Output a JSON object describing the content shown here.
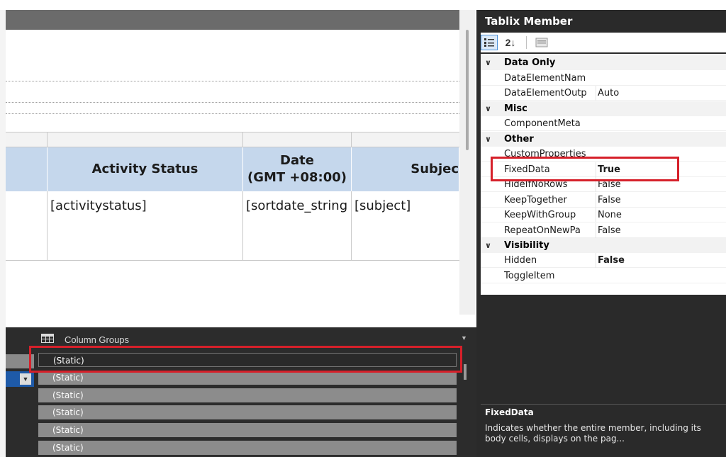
{
  "designer": {
    "headers": [
      {
        "label": ""
      },
      {
        "label": "Activity Status"
      },
      {
        "label": "Date\n(GMT +08:00)"
      },
      {
        "label": "Subjec"
      }
    ],
    "cells": [
      "",
      "[activitystatus]",
      "[sortdate_string",
      "[subject]"
    ]
  },
  "grouping": {
    "column_groups_title": "Column Groups",
    "column_groups": [
      "(Static)",
      "(Static)",
      "(Static)",
      "(Static)",
      "(Static)",
      "(Static)"
    ]
  },
  "properties": {
    "title": "Tablix Member",
    "toolbar": {
      "categorized_icon": "categorized-icon",
      "alphabetical_label": "2↓",
      "property_pages_icon": "property-pages-icon"
    },
    "categories": [
      {
        "name": "Data Only",
        "rows": [
          {
            "name": "DataElementNam",
            "value": ""
          },
          {
            "name": "DataElementOutp",
            "value": "Auto"
          }
        ]
      },
      {
        "name": "Misc",
        "rows": [
          {
            "name": "ComponentMeta",
            "value": ""
          }
        ]
      },
      {
        "name": "Other",
        "rows": [
          {
            "name": "CustomProperties",
            "value": ""
          },
          {
            "name": "FixedData",
            "value": "True"
          },
          {
            "name": "HideIfNoRows",
            "value": "False"
          },
          {
            "name": "KeepTogether",
            "value": "False"
          },
          {
            "name": "KeepWithGroup",
            "value": "None"
          },
          {
            "name": "RepeatOnNewPa",
            "value": "False"
          }
        ]
      },
      {
        "name": "Visibility",
        "rows": [
          {
            "name": "Hidden",
            "value": "False"
          },
          {
            "name": "ToggleItem",
            "value": ""
          }
        ]
      }
    ],
    "description": {
      "title": "FixedData",
      "text": "Indicates whether the entire member, including its body cells, displays on the pag..."
    }
  },
  "colors": {
    "highlight": "#d6202a",
    "header_fill": "#c5d7ec",
    "pane_dark": "#2a2a2a",
    "group_bar": "#8c8c8c"
  }
}
